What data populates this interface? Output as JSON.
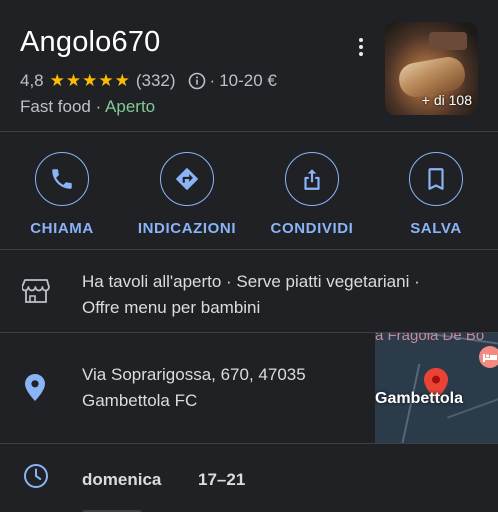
{
  "place": {
    "name": "Angolo670",
    "rating": "4,8",
    "stars": "★★★★★",
    "review_count": "(332)",
    "price_separator": "·",
    "price_range": "10-20 €",
    "category": "Fast food",
    "category_separator": " · ",
    "open_status": "Aperto",
    "photo_count_label": "+ di 108"
  },
  "actions": [
    {
      "label": "CHIAMA",
      "icon": "phone-icon"
    },
    {
      "label": "INDICAZIONI",
      "icon": "directions-icon"
    },
    {
      "label": "CONDIVIDI",
      "icon": "share-icon"
    },
    {
      "label": "SALVA",
      "icon": "bookmark-icon"
    }
  ],
  "features": {
    "icon": "storefront-icon",
    "line1": "Ha tavoli all'aperto · Serve piatti vegetariani ·",
    "line2": "Offre menu per bambini"
  },
  "address": {
    "icon": "location-pin-icon",
    "line1": "Via Soprarigossa, 670, 47035",
    "line2": "Gambettola FC",
    "map_top_label": "a Fragola De Bo",
    "map_town_label": "Gambettola"
  },
  "hours": {
    "icon": "clock-icon",
    "day": "domenica",
    "time": "17–21"
  },
  "colors": {
    "background": "#202124",
    "accent": "#8ab4f8",
    "open": "#81c995",
    "star": "#fbbc04"
  }
}
